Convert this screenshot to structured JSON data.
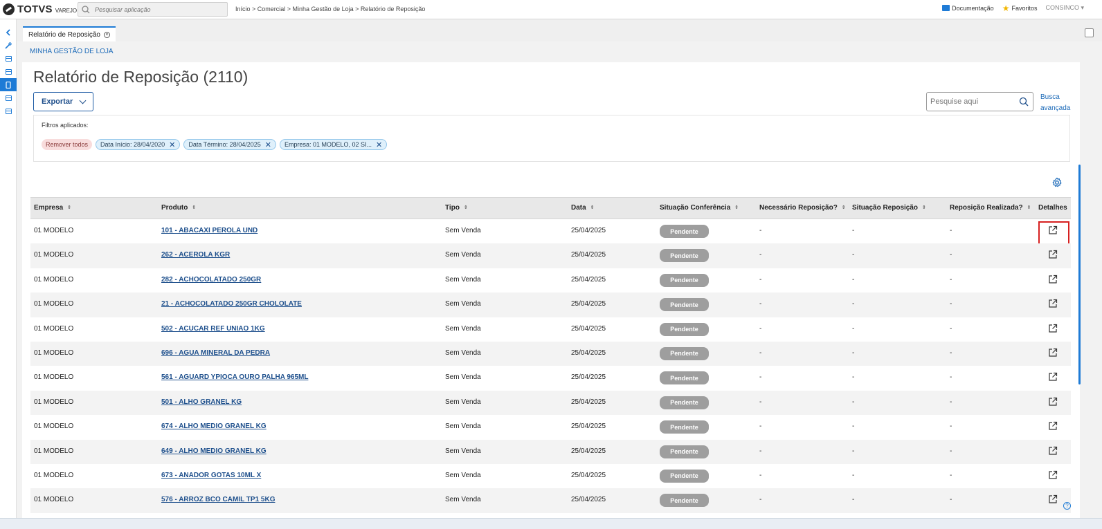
{
  "app": {
    "brand": "TOTVS",
    "brand_sub": "VAREJO",
    "app_search_placeholder": "Pesquisar aplicação",
    "breadcrumb": "Início > Comercial > Minha Gestão de Loja > Relatório de Reposição",
    "documentation_label": "Documentação",
    "favorites_label": "Favoritos",
    "user_label": "CONSINCO ▾"
  },
  "tabs": [
    {
      "label": "Relatório de Reposição",
      "close_icon": "close-circle-icon"
    }
  ],
  "section": {
    "title": "MINHA GESTÃO DE LOJA"
  },
  "page": {
    "title": "Relatório de Reposição (2110)",
    "export_label": "Exportar",
    "search_placeholder": "Pesquise aqui",
    "advanced_search_label": "Busca avançada"
  },
  "filters": {
    "label": "Filtros aplicados:",
    "remove_all": "Remover todos",
    "chips": [
      {
        "label": "Data Início: 28/04/2020"
      },
      {
        "label": "Data Término: 28/04/2025"
      },
      {
        "label": "Empresa: 01 MODELO, 02 SI..."
      }
    ]
  },
  "table": {
    "columns": [
      "Empresa",
      "Produto",
      "Tipo",
      "Data",
      "Situação Conferência",
      "Necessário Reposição?",
      "Situação Reposição",
      "Reposição Realizada?",
      "Detalhes"
    ],
    "rows": [
      {
        "empresa": "01 MODELO",
        "produto": "101 - ABACAXI PEROLA UND",
        "tipo": "Sem Venda",
        "data": "25/04/2025",
        "situacao": "Pendente",
        "necessario": "-",
        "sit_reposicao": "-",
        "realizada": "-"
      },
      {
        "empresa": "01 MODELO",
        "produto": "262 - ACEROLA KGR",
        "tipo": "Sem Venda",
        "data": "25/04/2025",
        "situacao": "Pendente",
        "necessario": "-",
        "sit_reposicao": "-",
        "realizada": "-"
      },
      {
        "empresa": "01 MODELO",
        "produto": "282 - ACHOCOLATADO 250GR",
        "tipo": "Sem Venda",
        "data": "25/04/2025",
        "situacao": "Pendente",
        "necessario": "-",
        "sit_reposicao": "-",
        "realizada": "-"
      },
      {
        "empresa": "01 MODELO",
        "produto": "21 - ACHOCOLATADO 250GR CHOLOLATE",
        "tipo": "Sem Venda",
        "data": "25/04/2025",
        "situacao": "Pendente",
        "necessario": "-",
        "sit_reposicao": "-",
        "realizada": "-"
      },
      {
        "empresa": "01 MODELO",
        "produto": "502 - ACUCAR REF UNIAO 1KG",
        "tipo": "Sem Venda",
        "data": "25/04/2025",
        "situacao": "Pendente",
        "necessario": "-",
        "sit_reposicao": "-",
        "realizada": "-"
      },
      {
        "empresa": "01 MODELO",
        "produto": "696 - AGUA MINERAL DA PEDRA",
        "tipo": "Sem Venda",
        "data": "25/04/2025",
        "situacao": "Pendente",
        "necessario": "-",
        "sit_reposicao": "-",
        "realizada": "-"
      },
      {
        "empresa": "01 MODELO",
        "produto": "561 - AGUARD YPIOCA OURO PALHA 965ML",
        "tipo": "Sem Venda",
        "data": "25/04/2025",
        "situacao": "Pendente",
        "necessario": "-",
        "sit_reposicao": "-",
        "realizada": "-"
      },
      {
        "empresa": "01 MODELO",
        "produto": "501 - ALHO GRANEL KG",
        "tipo": "Sem Venda",
        "data": "25/04/2025",
        "situacao": "Pendente",
        "necessario": "-",
        "sit_reposicao": "-",
        "realizada": "-"
      },
      {
        "empresa": "01 MODELO",
        "produto": "674 - ALHO MEDIO GRANEL KG",
        "tipo": "Sem Venda",
        "data": "25/04/2025",
        "situacao": "Pendente",
        "necessario": "-",
        "sit_reposicao": "-",
        "realizada": "-"
      },
      {
        "empresa": "01 MODELO",
        "produto": "649 - ALHO MEDIO GRANEL KG",
        "tipo": "Sem Venda",
        "data": "25/04/2025",
        "situacao": "Pendente",
        "necessario": "-",
        "sit_reposicao": "-",
        "realizada": "-"
      },
      {
        "empresa": "01 MODELO",
        "produto": "673 - ANADOR GOTAS 10ML X",
        "tipo": "Sem Venda",
        "data": "25/04/2025",
        "situacao": "Pendente",
        "necessario": "-",
        "sit_reposicao": "-",
        "realizada": "-"
      },
      {
        "empresa": "01 MODELO",
        "produto": "576 - ARROZ BCO CAMIL TP1 5KG",
        "tipo": "Sem Venda",
        "data": "25/04/2025",
        "situacao": "Pendente",
        "necessario": "-",
        "sit_reposicao": "-",
        "realizada": "-"
      }
    ]
  },
  "colors": {
    "accent": "#1e7bd6",
    "link": "#1d4f8c",
    "badge": "#9e9e9e",
    "highlight": "#d62020"
  },
  "help_label": "?"
}
